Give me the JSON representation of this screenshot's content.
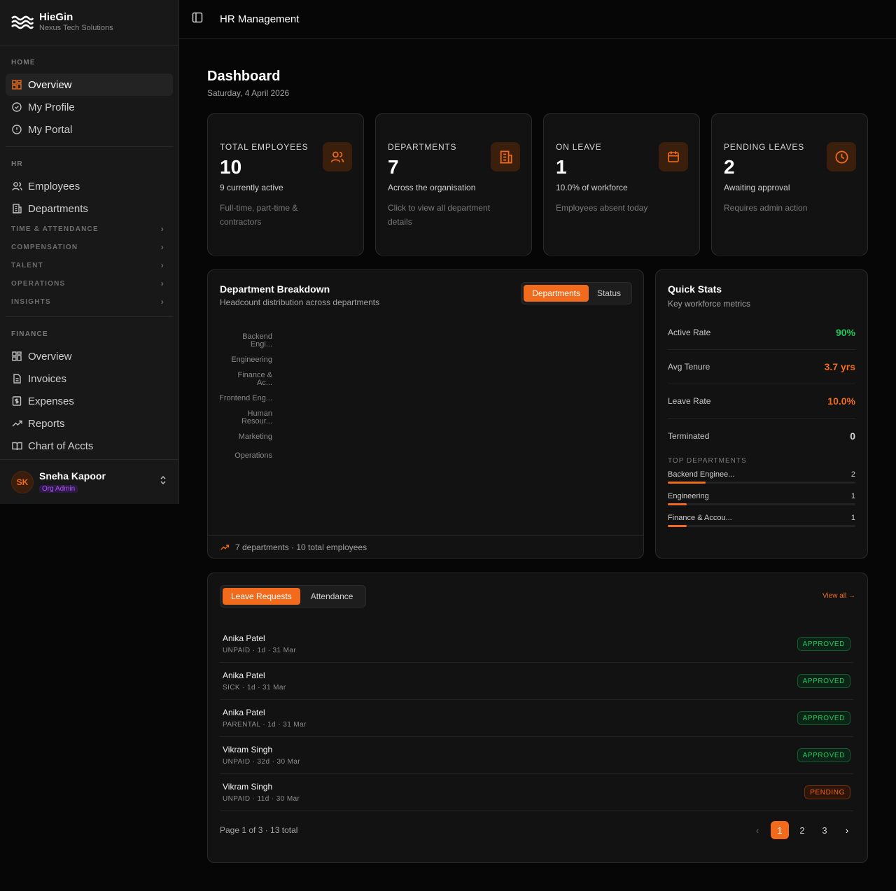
{
  "brand": {
    "name": "HieGin",
    "subtitle": "Nexus Tech Solutions"
  },
  "sidebar": {
    "home_label": "HOME",
    "home_items": [
      {
        "label": "Overview",
        "icon": "grid-icon"
      },
      {
        "label": "My Profile",
        "icon": "check-circle-icon"
      },
      {
        "label": "My Portal",
        "icon": "alert-circle-icon"
      }
    ],
    "hr_label": "HR",
    "hr_items": [
      {
        "label": "Employees",
        "icon": "users-icon"
      },
      {
        "label": "Departments",
        "icon": "building-icon"
      }
    ],
    "collapsibles": [
      "TIME & ATTENDANCE",
      "COMPENSATION",
      "TALENT",
      "OPERATIONS",
      "INSIGHTS"
    ],
    "finance_label": "FINANCE",
    "finance_items": [
      {
        "label": "Overview",
        "icon": "grid-icon"
      },
      {
        "label": "Invoices",
        "icon": "file-icon"
      },
      {
        "label": "Expenses",
        "icon": "receipt-icon"
      },
      {
        "label": "Reports",
        "icon": "trending-icon"
      },
      {
        "label": "Chart of Accts",
        "icon": "book-icon"
      }
    ],
    "user": {
      "initials": "SK",
      "name": "Sneha Kapoor",
      "role": "Org Admin"
    }
  },
  "topbar": {
    "title": "HR Management"
  },
  "dashboard": {
    "title": "Dashboard",
    "date": "Saturday, 4 April 2026"
  },
  "stats": [
    {
      "label": "TOTAL EMPLOYEES",
      "value": "10",
      "sub": "9 currently active",
      "desc": "Full-time, part-time & contractors",
      "icon": "users-icon"
    },
    {
      "label": "DEPARTMENTS",
      "value": "7",
      "sub": "Across the organisation",
      "desc": "Click to view all department details",
      "icon": "building-icon"
    },
    {
      "label": "ON LEAVE",
      "value": "1",
      "sub": "10.0% of workforce",
      "desc": "Employees absent today",
      "icon": "calendar-icon"
    },
    {
      "label": "PENDING LEAVES",
      "value": "2",
      "sub": "Awaiting approval",
      "desc": "Requires admin action",
      "icon": "clock-icon"
    }
  ],
  "breakdown": {
    "title": "Department Breakdown",
    "subtitle": "Headcount distribution across departments",
    "tabs": [
      "Departments",
      "Status"
    ],
    "footer": "7 departments · 10 total employees",
    "labels": [
      {
        "lines": [
          "Backend",
          "Engi..."
        ]
      },
      {
        "lines": [
          "Engineering"
        ]
      },
      {
        "lines": [
          "Finance &",
          "Ac..."
        ]
      },
      {
        "lines": [
          "Frontend Eng..."
        ]
      },
      {
        "lines": [
          "Human",
          "Resour..."
        ]
      },
      {
        "lines": [
          "Marketing"
        ]
      },
      {
        "lines": [
          "Operations"
        ]
      }
    ]
  },
  "quick_stats": {
    "title": "Quick Stats",
    "subtitle": "Key workforce metrics",
    "rows": [
      {
        "label": "Active Rate",
        "value": "90%",
        "color": "#22c55e"
      },
      {
        "label": "Avg Tenure",
        "value": "3.7 yrs",
        "color": "#f26a1b"
      },
      {
        "label": "Leave Rate",
        "value": "10.0%",
        "color": "#f26a1b"
      },
      {
        "label": "Terminated",
        "value": "0",
        "color": "#d4d4d4"
      }
    ],
    "top_label": "TOP DEPARTMENTS",
    "top_departments": [
      {
        "name": "Backend Enginee...",
        "count": "2",
        "fraction": 0.2
      },
      {
        "name": "Engineering",
        "count": "1",
        "fraction": 0.1
      },
      {
        "name": "Finance & Accou...",
        "count": "1",
        "fraction": 0.1
      }
    ]
  },
  "requests": {
    "tabs": [
      "Leave Requests",
      "Attendance"
    ],
    "view_all": "View all →",
    "rows": [
      {
        "name": "Anika Patel",
        "meta": "UNPAID · 1d · 31 Mar",
        "status": "APPROVED",
        "kind": "approved"
      },
      {
        "name": "Anika Patel",
        "meta": "SICK · 1d · 31 Mar",
        "status": "APPROVED",
        "kind": "approved"
      },
      {
        "name": "Anika Patel",
        "meta": "PARENTAL · 1d · 31 Mar",
        "status": "APPROVED",
        "kind": "approved"
      },
      {
        "name": "Vikram Singh",
        "meta": "UNPAID · 32d · 30 Mar",
        "status": "APPROVED",
        "kind": "approved"
      },
      {
        "name": "Vikram Singh",
        "meta": "UNPAID · 11d · 30 Mar",
        "status": "PENDING",
        "kind": "pending"
      }
    ],
    "page_info": "Page 1 of 3 · 13 total",
    "pages": [
      "1",
      "2",
      "3"
    ]
  },
  "colors": {
    "accent": "#f26a1b",
    "success": "#22c55e"
  }
}
